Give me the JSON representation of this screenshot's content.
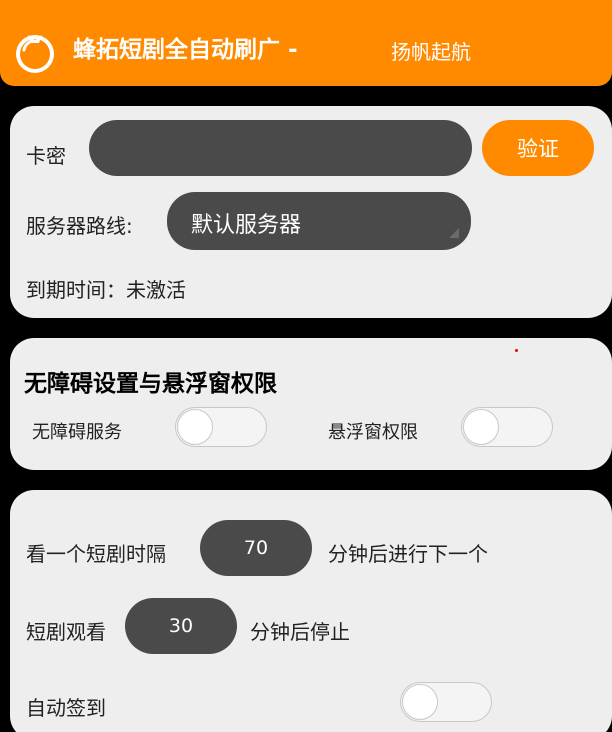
{
  "header": {
    "title": "蜂拓短剧全自动刷广 -",
    "subtitle": "扬帆起航",
    "logo_icon": "tomato-logo-icon",
    "background_color": "#ff8a00"
  },
  "license": {
    "card_key_label": "卡密",
    "card_key_value": "",
    "verify_button": "验证",
    "server_label": "服务器路线:",
    "server_selected": "默认服务器",
    "expire_label": "到期时间：未激活"
  },
  "permissions": {
    "title": "无障碍设置与悬浮窗权限",
    "accessibility_label": "无障碍服务",
    "accessibility_on": false,
    "overlay_label": "悬浮窗权限",
    "overlay_on": false
  },
  "settings": {
    "interval_prefix": "看一个短剧时隔",
    "interval_value": "70",
    "interval_suffix": "分钟后进行下一个",
    "watch_prefix": "短剧观看",
    "watch_value": "30",
    "watch_suffix": "分钟后停止",
    "auto_signin_label": "自动签到",
    "auto_signin_on": false
  }
}
